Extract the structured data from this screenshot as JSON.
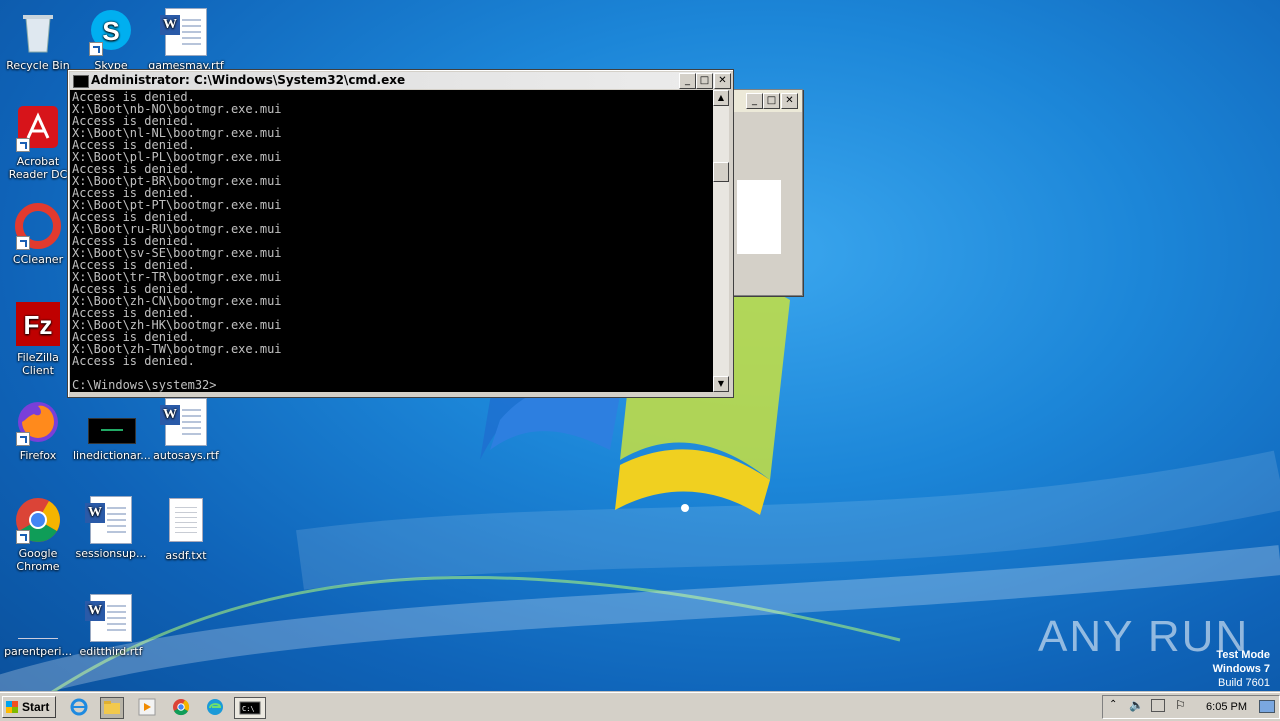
{
  "desktop": {
    "icons": [
      {
        "label": "Recycle Bin"
      },
      {
        "label": "Skype"
      },
      {
        "label": "gamesmay.rtf"
      },
      {
        "label": "Acrobat Reader DC"
      },
      {
        "label": "CCleaner"
      },
      {
        "label": "FileZilla Client"
      },
      {
        "label": "Firefox"
      },
      {
        "label": "linedictionar..."
      },
      {
        "label": "autosays.rtf"
      },
      {
        "label": "Google Chrome"
      },
      {
        "label": "sessionsup..."
      },
      {
        "label": "asdf.txt"
      },
      {
        "label": "parentperi..."
      },
      {
        "label": "editthird.rtf"
      }
    ]
  },
  "cmd_window": {
    "title": "Administrator: C:\\Windows\\System32\\cmd.exe",
    "console_text": "Access is denied.\nX:\\Boot\\nb-NO\\bootmgr.exe.mui\nAccess is denied.\nX:\\Boot\\nl-NL\\bootmgr.exe.mui\nAccess is denied.\nX:\\Boot\\pl-PL\\bootmgr.exe.mui\nAccess is denied.\nX:\\Boot\\pt-BR\\bootmgr.exe.mui\nAccess is denied.\nX:\\Boot\\pt-PT\\bootmgr.exe.mui\nAccess is denied.\nX:\\Boot\\ru-RU\\bootmgr.exe.mui\nAccess is denied.\nX:\\Boot\\sv-SE\\bootmgr.exe.mui\nAccess is denied.\nX:\\Boot\\tr-TR\\bootmgr.exe.mui\nAccess is denied.\nX:\\Boot\\zh-CN\\bootmgr.exe.mui\nAccess is denied.\nX:\\Boot\\zh-HK\\bootmgr.exe.mui\nAccess is denied.\nX:\\Boot\\zh-TW\\bootmgr.exe.mui\nAccess is denied.\n\nC:\\Windows\\system32>",
    "minimize": "_",
    "maximize": "□",
    "close": "✕"
  },
  "back_window": {
    "minimize": "_",
    "maximize": "□",
    "close": "✕"
  },
  "taskbar": {
    "start_label": "Start",
    "clock": "6:05 PM"
  },
  "watermark": {
    "line1": "Test Mode",
    "line2": "Windows 7",
    "line3": "Build 7601",
    "brand": "ANY RUN"
  },
  "colors": {
    "desktop_bg": "#1c86d8",
    "console_bg": "#000000",
    "console_fg": "#c0c0c0",
    "taskbar_bg": "#d4d0c8"
  }
}
